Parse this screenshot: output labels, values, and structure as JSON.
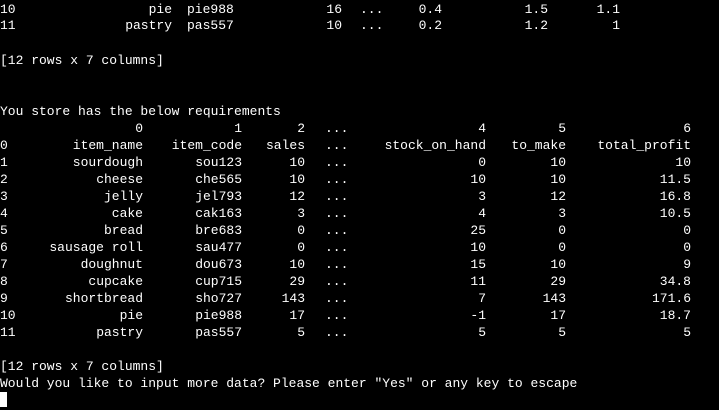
{
  "terminal": {
    "top_rows": [
      {
        "idx": "10",
        "item": "pie",
        "code": "pie988",
        "sales": "16",
        "dots": "...",
        "c4": "0.4",
        "c5": "1.5",
        "c6": "1.1"
      },
      {
        "idx": "11",
        "item": "pastry",
        "code": "pas557",
        "sales": "10",
        "dots": "...",
        "c4": "0.2",
        "c5": "1.2",
        "c6": "1"
      }
    ],
    "shape_line_1": "[12 rows x 7 columns]",
    "requirements_line": "You store has the below requirements",
    "column_numbers": [
      "0",
      "1",
      "2",
      "...",
      "4",
      "5",
      "6"
    ],
    "header_row": {
      "idx": "0",
      "item": "item_name",
      "code": "item_code",
      "sales": "sales",
      "dots": "...",
      "c4": "stock_on_hand",
      "c5": "to_make",
      "c6": "total_profit"
    },
    "rows": [
      {
        "idx": "1",
        "item": "sourdough",
        "code": "sou123",
        "sales": "10",
        "dots": "...",
        "c4": "0",
        "c5": "10",
        "c6": "10"
      },
      {
        "idx": "2",
        "item": "cheese",
        "code": "che565",
        "sales": "10",
        "dots": "...",
        "c4": "10",
        "c5": "10",
        "c6": "11.5"
      },
      {
        "idx": "3",
        "item": "jelly",
        "code": "jel793",
        "sales": "12",
        "dots": "...",
        "c4": "3",
        "c5": "12",
        "c6": "16.8"
      },
      {
        "idx": "4",
        "item": "cake",
        "code": "cak163",
        "sales": "3",
        "dots": "...",
        "c4": "4",
        "c5": "3",
        "c6": "10.5"
      },
      {
        "idx": "5",
        "item": "bread",
        "code": "bre683",
        "sales": "0",
        "dots": "...",
        "c4": "25",
        "c5": "0",
        "c6": "0"
      },
      {
        "idx": "6",
        "item": "sausage roll",
        "code": "sau477",
        "sales": "0",
        "dots": "...",
        "c4": "10",
        "c5": "0",
        "c6": "0"
      },
      {
        "idx": "7",
        "item": "doughnut",
        "code": "dou673",
        "sales": "10",
        "dots": "...",
        "c4": "15",
        "c5": "10",
        "c6": "9"
      },
      {
        "idx": "8",
        "item": "cupcake",
        "code": "cup715",
        "sales": "29",
        "dots": "...",
        "c4": "11",
        "c5": "29",
        "c6": "34.8"
      },
      {
        "idx": "9",
        "item": "shortbread",
        "code": "sho727",
        "sales": "143",
        "dots": "...",
        "c4": "7",
        "c5": "143",
        "c6": "171.6"
      },
      {
        "idx": "10",
        "item": "pie",
        "code": "pie988",
        "sales": "17",
        "dots": "...",
        "c4": "-1",
        "c5": "17",
        "c6": "18.7"
      },
      {
        "idx": "11",
        "item": "pastry",
        "code": "pas557",
        "sales": "5",
        "dots": "...",
        "c4": "5",
        "c5": "5",
        "c6": "5"
      }
    ],
    "shape_line_2": "[12 rows x 7 columns]",
    "prompt_line": "Would you like to input more data? Please enter \"Yes\" or any key to escape"
  }
}
